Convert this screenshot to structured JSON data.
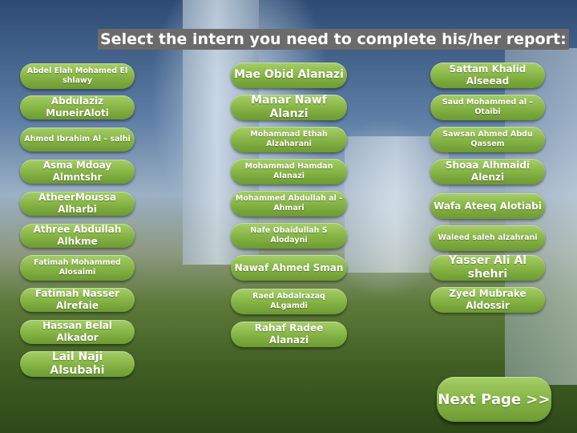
{
  "title": "Select the intern you need to complete his/her report:",
  "interns": {
    "col1": [
      "Abdel Elah Mohamed El shlawy",
      "Abdulaziz MuneirAloti",
      "Ahmed Ibrahim Al – salhi",
      "Asma Mdoay Almntshr",
      "AtheerMoussa Alharbi",
      "Athree Abdullah Alhkme",
      "Fatimah Mohammed Alosaimi",
      "Fatimah Nasser Alrefaie",
      "Hassan Belal Alkador",
      "Lail Naji Alsubahi"
    ],
    "col2": [
      "Mae Obid Alanazi",
      "Manar Nawf Alanzi",
      "Mohammad Ethah Alzaharani",
      "Mohammad Hamdan Alanazi",
      "Mohammed Abdullah al - Ahmari",
      "Nafe Obaidullah S Alodayni",
      "Nawaf Ahmed Sman",
      "Raed Abdalrazaq ALgamdi",
      "Rahaf Radee  Alanazi"
    ],
    "col3": [
      "Sattam Khalid Alseead",
      "Saud Mohammed al – Otaibi",
      "Sawsan Ahmed Abdu Qassem",
      "Shoaa Alhmaidi Alenzi",
      "Wafa Ateeq Alotiabi",
      "Waleed saleh alzahrani",
      "Yasser Ali Al shehri",
      "Zyed Mubrake Aldossir"
    ]
  },
  "next_button": "Next Page >>",
  "colors": {
    "button_green": "#84b243",
    "title_bg": "#6b6b6b"
  }
}
